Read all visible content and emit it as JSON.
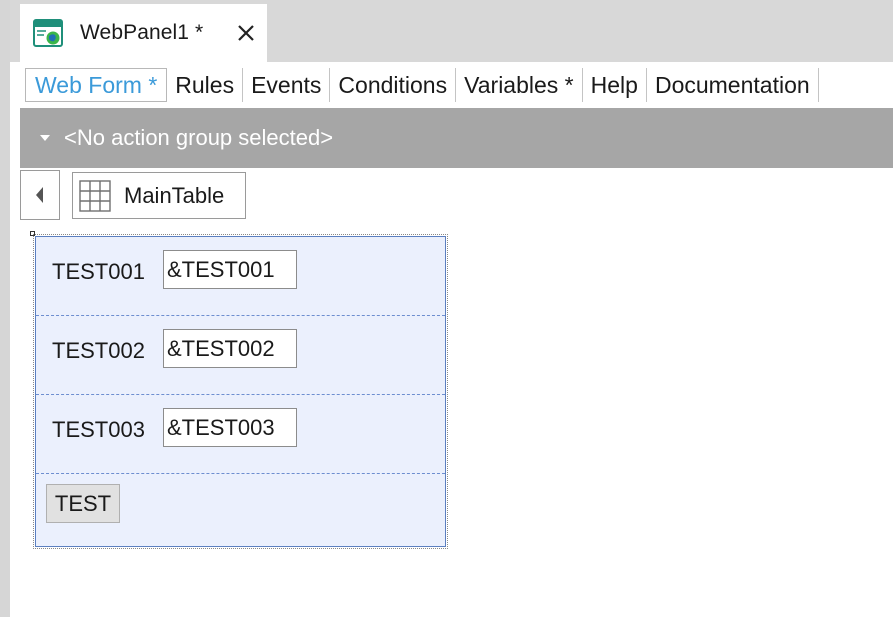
{
  "document_tab": {
    "title": "WebPanel1 *",
    "icon": "webpanel-icon",
    "close_icon": "close-icon"
  },
  "subtabs": [
    {
      "label": "Web Form *",
      "active": true
    },
    {
      "label": "Rules",
      "active": false
    },
    {
      "label": "Events",
      "active": false
    },
    {
      "label": "Conditions",
      "active": false
    },
    {
      "label": "Variables *",
      "active": false
    },
    {
      "label": "Help",
      "active": false
    },
    {
      "label": "Documentation",
      "active": false
    }
  ],
  "action_group": {
    "text": "<No action group selected>",
    "icon": "caret-down-icon"
  },
  "breadcrumb": {
    "back_icon": "chevron-left-icon",
    "item_icon": "table-grid-icon",
    "label": "MainTable"
  },
  "form": {
    "rows": [
      {
        "label": "TEST001",
        "value": "&TEST001"
      },
      {
        "label": "TEST002",
        "value": "&TEST002"
      },
      {
        "label": "TEST003",
        "value": "&TEST003"
      }
    ],
    "button_label": "TEST"
  },
  "colors": {
    "active_tab": "#3b9ad9",
    "action_bar": "#a6a6a6",
    "form_background": "#ebf0fd",
    "form_border": "#5b7fc0"
  }
}
